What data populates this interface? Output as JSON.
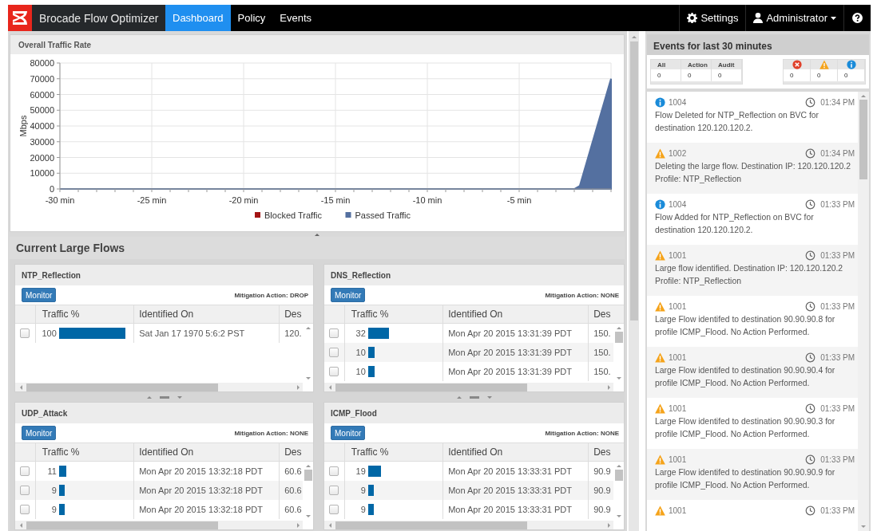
{
  "navbar": {
    "brand": "Brocade Flow Optimizer",
    "tabs": [
      {
        "label": "Dashboard",
        "selected": true
      },
      {
        "label": "Policy",
        "selected": false
      },
      {
        "label": "Events",
        "selected": false
      }
    ],
    "settings": "Settings",
    "user": "Administrator"
  },
  "traffic_panel": {
    "title": "Overall Traffic Rate",
    "chart_data": {
      "type": "area",
      "ylabel": "Mbps",
      "x": [
        -30,
        -2,
        -1.7,
        0
      ],
      "series": [
        {
          "name": "Blocked Traffic",
          "color": "#a31515",
          "values": [
            null,
            null,
            null,
            null
          ]
        },
        {
          "name": "Passed Traffic",
          "color": "#5470a0",
          "values": [
            0,
            0,
            2000,
            70000
          ]
        }
      ],
      "xlim": [
        -30,
        0
      ],
      "ylim": [
        0,
        80000
      ],
      "grid": true,
      "xticks": [
        {
          "value": -30,
          "label": "-30 min"
        },
        {
          "value": -25,
          "label": "-25 min"
        },
        {
          "value": -20,
          "label": "-20 min"
        },
        {
          "value": -15,
          "label": "-15 min"
        },
        {
          "value": -10,
          "label": "-10 min"
        },
        {
          "value": -5,
          "label": "-5 min"
        }
      ],
      "yticks": [
        0,
        10000,
        20000,
        30000,
        40000,
        50000,
        60000,
        70000,
        80000
      ]
    }
  },
  "flows": {
    "title": "Current Large Flows",
    "panels": [
      {
        "title": "NTP_Reflection",
        "action_button": "Monitor",
        "mitigation": "Mitigation Action: DROP",
        "columns": [
          "Traffic %",
          "Identified On",
          "Des"
        ],
        "rows": [
          {
            "checked": false,
            "traffic": "100",
            "identified_on": "Sat Jan 17 1970 5:6:2 PST",
            "column_3": "120."
          }
        ]
      },
      {
        "title": "DNS_Reflection",
        "action_button": "Monitor",
        "mitigation": "Mitigation Action: NONE",
        "columns": [
          "Traffic %",
          "Identified On",
          "Des"
        ],
        "rows": [
          {
            "checked": false,
            "traffic": "32",
            "identified_on": "Mon Apr 20 2015 13:31:39 PDT",
            "column_3": "150."
          },
          {
            "checked": false,
            "traffic": "10",
            "identified_on": "Mon Apr 20 2015 13:31:39 PDT",
            "column_3": "150."
          },
          {
            "checked": false,
            "traffic": "10",
            "identified_on": "Mon Apr 20 2015 13:31:39 PDT",
            "column_3": "150."
          }
        ]
      },
      {
        "title": "UDP_Attack",
        "action_button": "Monitor",
        "mitigation": "Mitigation Action: NONE",
        "columns": [
          "Traffic %",
          "Identified On",
          "Des"
        ],
        "rows": [
          {
            "checked": false,
            "traffic": "11",
            "identified_on": "Mon Apr 20 2015 13:32:18 PDT",
            "column_3": "60.6"
          },
          {
            "checked": false,
            "traffic": "9",
            "identified_on": "Mon Apr 20 2015 13:32:18 PDT",
            "column_3": "60.6"
          },
          {
            "checked": false,
            "traffic": "9",
            "identified_on": "Mon Apr 20 2015 13:32:18 PDT",
            "column_3": "60.6"
          }
        ]
      },
      {
        "title": "ICMP_Flood",
        "action_button": "Monitor",
        "mitigation": "Mitigation Action: NONE",
        "columns": [
          "Traffic %",
          "Identified On",
          "Des"
        ],
        "rows": [
          {
            "checked": false,
            "traffic": "19",
            "identified_on": "Mon Apr 20 2015 13:33:31 PDT",
            "column_3": "90.9"
          },
          {
            "checked": false,
            "traffic": "9",
            "identified_on": "Mon Apr 20 2015 13:33:31 PDT",
            "column_3": "90.9"
          },
          {
            "checked": false,
            "traffic": "9",
            "identified_on": "Mon Apr 20 2015 13:33:31 PDT",
            "column_3": "90.9"
          }
        ]
      }
    ]
  },
  "events_panel": {
    "title": "Events for last 30 minutes",
    "counters": [
      {
        "label": "All",
        "value": "0"
      },
      {
        "label": "Action",
        "value": "0"
      },
      {
        "label": "Audit",
        "value": "0"
      }
    ],
    "severity_counters": [
      {
        "kind": "error",
        "value": "0"
      },
      {
        "kind": "warning",
        "value": "0"
      },
      {
        "kind": "info",
        "value": "0"
      }
    ],
    "events": [
      {
        "kind": "info",
        "code": "1004",
        "time": "01:34 PM",
        "message": "Flow Deleted for NTP_Reflection on BVC for destination 120.120.120.2."
      },
      {
        "kind": "warning",
        "code": "1002",
        "time": "01:34 PM",
        "message": "Deleting the large flow. Destination IP: 120.120.120.2 Profile: NTP_Reflection"
      },
      {
        "kind": "info",
        "code": "1004",
        "time": "01:33 PM",
        "message": "Flow Added for NTP_Reflection on BVC for destination 120.120.120.2."
      },
      {
        "kind": "warning",
        "code": "1001",
        "time": "01:33 PM",
        "message": "Large flow identified. Destination IP: 120.120.120.2 Profile: NTP_Reflection"
      },
      {
        "kind": "warning",
        "code": "1001",
        "time": "01:33 PM",
        "message": "Large Flow identifed to destination 90.90.90.8 for profile ICMP_Flood. No Action Performed."
      },
      {
        "kind": "warning",
        "code": "1001",
        "time": "01:33 PM",
        "message": "Large Flow identifed to destination 90.90.90.4 for profile ICMP_Flood. No Action Performed."
      },
      {
        "kind": "warning",
        "code": "1001",
        "time": "01:33 PM",
        "message": "Large Flow identifed to destination 90.90.90.3 for profile ICMP_Flood. No Action Performed."
      },
      {
        "kind": "warning",
        "code": "1001",
        "time": "01:33 PM",
        "message": "Large Flow identifed to destination 90.90.90.9 for profile ICMP_Flood. No Action Performed."
      },
      {
        "kind": "warning",
        "code": "1001",
        "time": "01:33 PM"
      }
    ]
  }
}
